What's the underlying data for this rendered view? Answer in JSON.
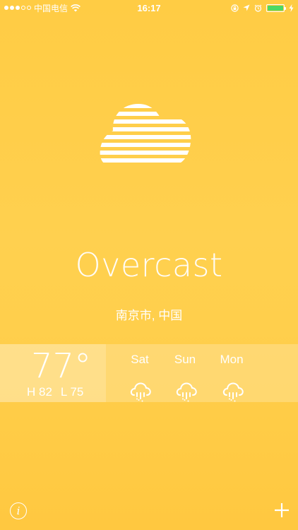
{
  "status_bar": {
    "carrier": "中国电信",
    "time": "16:17",
    "battery_color": "#4CD964"
  },
  "weather": {
    "condition": "Overcast",
    "location": "南京市, 中国",
    "icon": "overcast-cloud-icon"
  },
  "current": {
    "temperature": "77°",
    "high": "H 82",
    "low": "L 75"
  },
  "forecast": [
    {
      "day": "Sat",
      "icon": "rain-cloud-icon"
    },
    {
      "day": "Sun",
      "icon": "rain-cloud-icon"
    },
    {
      "day": "Mon",
      "icon": "rain-cloud-icon"
    }
  ],
  "bottom": {
    "info_icon": "info-icon",
    "add_icon": "plus-icon",
    "info_glyph": "i"
  },
  "colors": {
    "background": "#FFCC44",
    "foreground": "#FFFFFF"
  }
}
